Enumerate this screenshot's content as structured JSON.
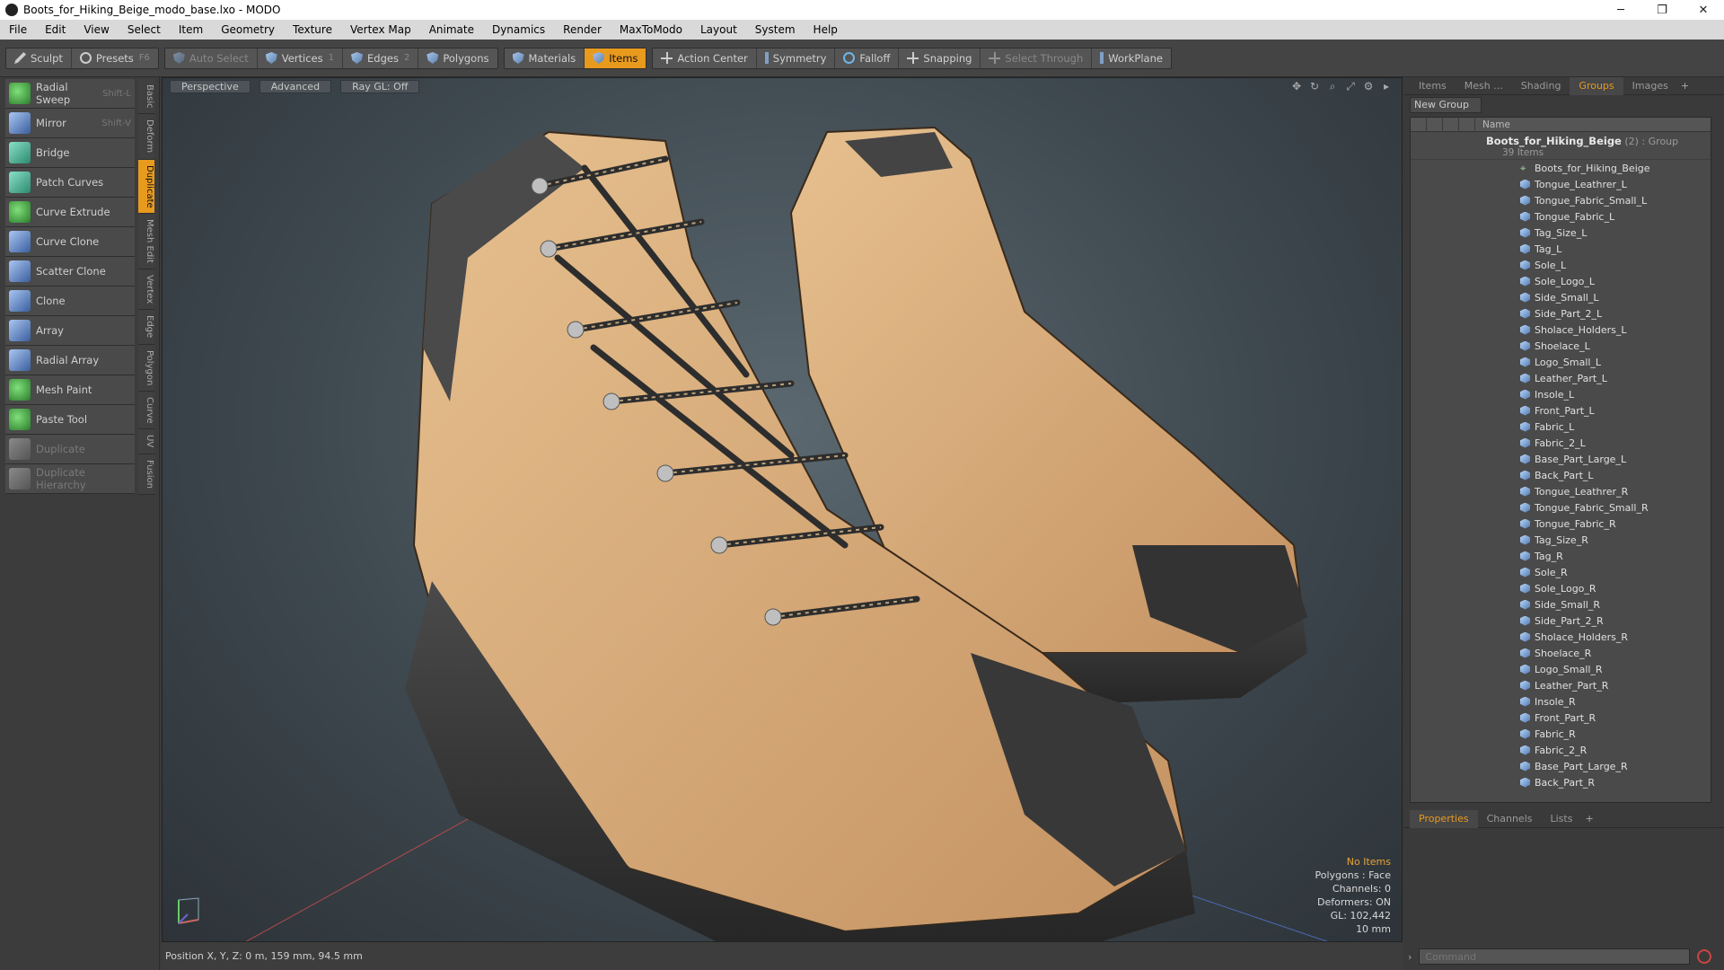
{
  "window": {
    "title": "Boots_for_Hiking_Beige_modo_base.lxo - MODO",
    "minimize": "─",
    "maximize": "❐",
    "close": "✕"
  },
  "menu": [
    "File",
    "Edit",
    "View",
    "Select",
    "Item",
    "Geometry",
    "Texture",
    "Vertex Map",
    "Animate",
    "Dynamics",
    "Render",
    "MaxToModo",
    "Layout",
    "System",
    "Help"
  ],
  "toolbar": {
    "sculpt": "Sculpt",
    "presets": "Presets",
    "presets_key": "F6",
    "auto_select": "Auto Select",
    "vertices": "Vertices",
    "vertices_key": "1",
    "edges": "Edges",
    "edges_key": "2",
    "polygons": "Polygons",
    "materials": "Materials",
    "items": "Items",
    "action_center": "Action Center",
    "symmetry": "Symmetry",
    "falloff": "Falloff",
    "snapping": "Snapping",
    "select_through": "Select Through",
    "workplane": "WorkPlane"
  },
  "tools": [
    {
      "label": "Radial Sweep",
      "key": "Shift-L"
    },
    {
      "label": "Mirror",
      "key": "Shift-V"
    },
    {
      "label": "Bridge",
      "key": ""
    },
    {
      "label": "Patch Curves",
      "key": ""
    },
    {
      "label": "Curve Extrude",
      "key": ""
    },
    {
      "label": "Curve Clone",
      "key": ""
    },
    {
      "label": "Scatter Clone",
      "key": ""
    },
    {
      "label": "Clone",
      "key": ""
    },
    {
      "label": "Array",
      "key": ""
    },
    {
      "label": "Radial Array",
      "key": ""
    },
    {
      "label": "Mesh Paint",
      "key": ""
    },
    {
      "label": "Paste Tool",
      "key": ""
    },
    {
      "label": "Duplicate",
      "key": ""
    },
    {
      "label": "Duplicate Hierarchy",
      "key": ""
    }
  ],
  "vertical_tabs": [
    "Basic",
    "Deform",
    "Duplicate",
    "Mesh Edit",
    "Vertex",
    "Edge",
    "Polygon",
    "Curve",
    "UV",
    "Fusion"
  ],
  "viewport": {
    "view": "Perspective",
    "shading": "Advanced",
    "raygl": "Ray GL: Off",
    "info": {
      "no_items": "No Items",
      "polygons": "Polygons : Face",
      "channels": "Channels: 0",
      "deformers": "Deformers: ON",
      "gl": "GL: 102,442",
      "scale": "10 mm"
    },
    "status": "Position X, Y, Z:  0 m, 159 mm, 94.5 mm"
  },
  "right_panel": {
    "tabs": [
      "Items",
      "Mesh ...",
      "Shading",
      "Groups",
      "Images"
    ],
    "new_group": "New Group",
    "name_header": "Name",
    "group_name": "Boots_for_Hiking_Beige",
    "group_suffix": "(2) : Group",
    "group_count": "39 Items",
    "items": [
      "Boots_for_Hiking_Beige",
      "Tongue_Leathrer_L",
      "Tongue_Fabric_Small_L",
      "Tongue_Fabric_L",
      "Tag_Size_L",
      "Tag_L",
      "Sole_L",
      "Sole_Logo_L",
      "Side_Small_L",
      "Side_Part_2_L",
      "Sholace_Holders_L",
      "Shoelace_L",
      "Logo_Small_L",
      "Leather_Part_L",
      "Insole_L",
      "Front_Part_L",
      "Fabric_L",
      "Fabric_2_L",
      "Base_Part_Large_L",
      "Back_Part_L",
      "Tongue_Leathrer_R",
      "Tongue_Fabric_Small_R",
      "Tongue_Fabric_R",
      "Tag_Size_R",
      "Tag_R",
      "Sole_R",
      "Sole_Logo_R",
      "Side_Small_R",
      "Side_Part_2_R",
      "Sholace_Holders_R",
      "Shoelace_R",
      "Logo_Small_R",
      "Leather_Part_R",
      "Insole_R",
      "Front_Part_R",
      "Fabric_R",
      "Fabric_2_R",
      "Base_Part_Large_R",
      "Back_Part_R"
    ],
    "bottom_tabs": [
      "Properties",
      "Channels",
      "Lists"
    ],
    "command_placeholder": "Command"
  }
}
